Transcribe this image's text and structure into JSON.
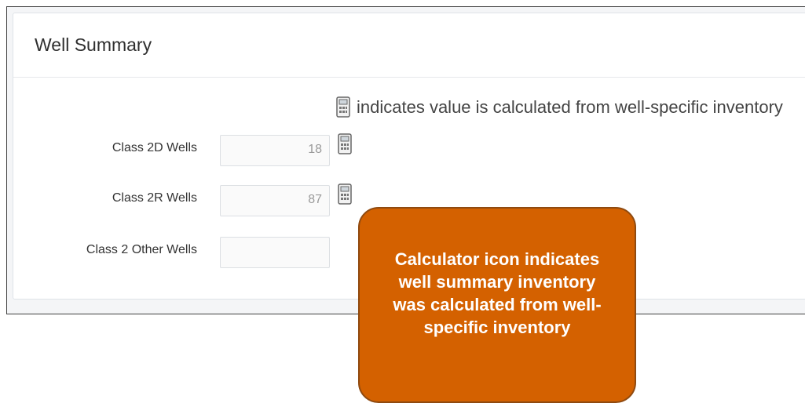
{
  "panel": {
    "title": "Well Summary",
    "legend_text": "indicates value is calculated from well-specific inventory",
    "legend_icon": "calculator-icon"
  },
  "rows": [
    {
      "label": "Class 2D Wells",
      "value": "18",
      "calculated": true
    },
    {
      "label": "Class 2R Wells",
      "value": "87",
      "calculated": true
    },
    {
      "label": "Class 2 Other Wells",
      "value": "",
      "calculated": false
    }
  ],
  "callout": {
    "lines": [
      "Calculator icon indicates",
      "well summary inventory",
      "was calculated from well-",
      "specific inventory"
    ],
    "color": "#d46100"
  }
}
